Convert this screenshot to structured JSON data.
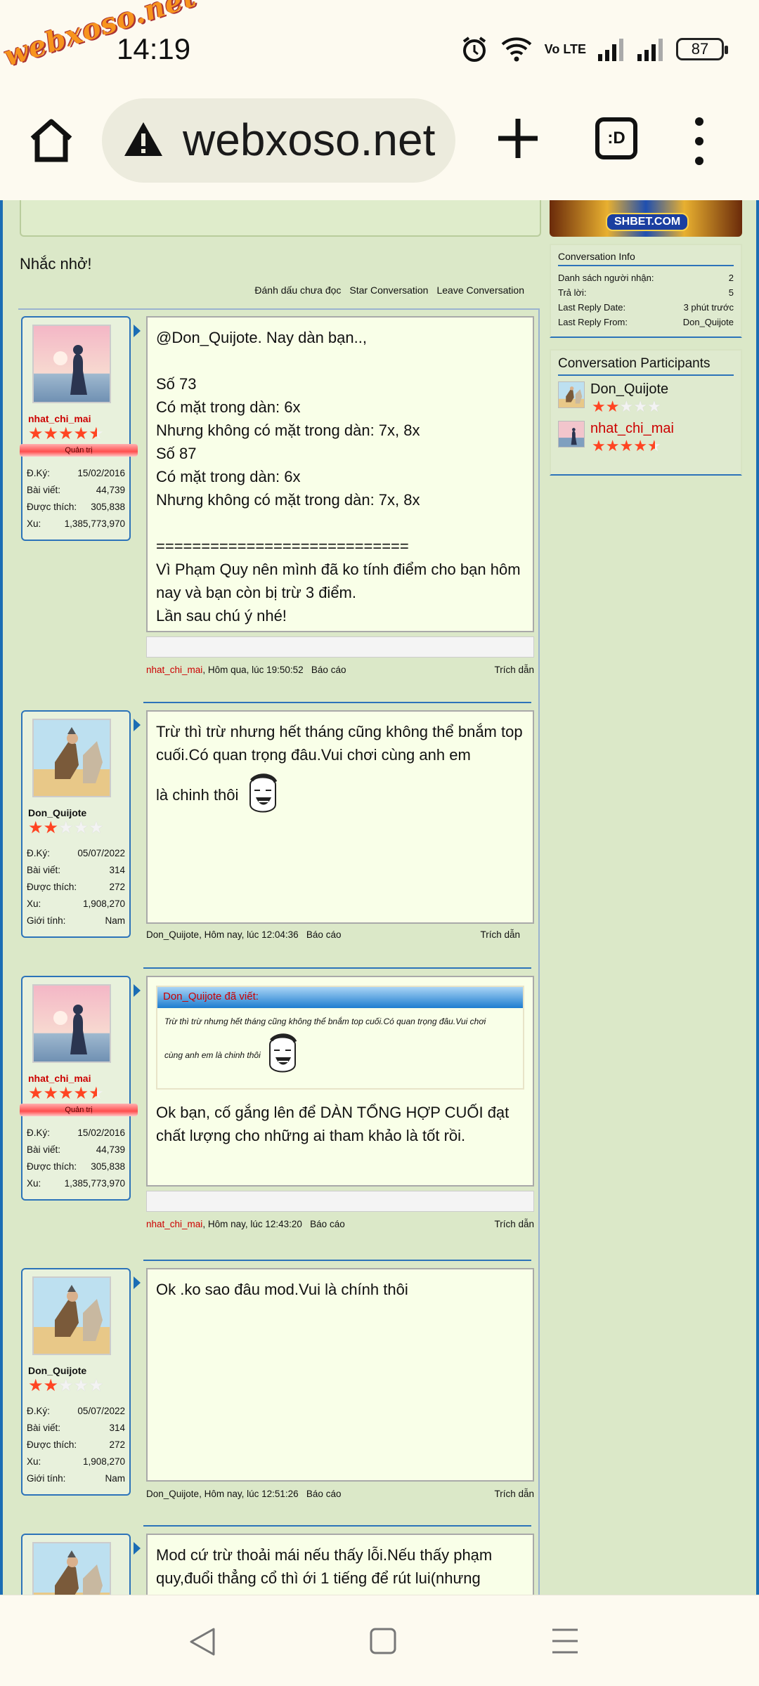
{
  "status": {
    "watermark": "webxoso.net",
    "time": "14:19",
    "volte": "Vo LTE",
    "battery": "87"
  },
  "browser": {
    "url": "webxoso.net",
    "tabs_label": ":D"
  },
  "conversation": {
    "title": "Nhắc nhở!",
    "actions": [
      "Đánh dấu chưa đọc",
      "Star Conversation",
      "Leave Conversation"
    ]
  },
  "users": {
    "nhat": {
      "name": "nhat_chi_mai",
      "role": "Quản trị",
      "rating": 4.5,
      "stats": [
        [
          "Đ.Ký:",
          "15/02/2016"
        ],
        [
          "Bài viết:",
          "44,739"
        ],
        [
          "Được thích:",
          "305,838"
        ],
        [
          "Xu:",
          "1,385,773,970"
        ]
      ]
    },
    "don": {
      "name": "Don_Quijote",
      "rating": 2,
      "stats": [
        [
          "Đ.Ký:",
          "05/07/2022"
        ],
        [
          "Bài viết:",
          "314"
        ],
        [
          "Được thích:",
          "272"
        ],
        [
          "Xu:",
          "1,908,270"
        ],
        [
          "Giới tính:",
          "Nam"
        ]
      ]
    }
  },
  "posts": [
    {
      "user": "nhat",
      "lines": [
        "@Don_Quijote. Nay dàn bạn..,",
        "",
        "Số 73",
        "Có mặt trong dàn: 6x",
        "Nhưng không có mặt trong dàn: 7x, 8x",
        "Số 87",
        "Có mặt trong dàn: 6x",
        "Nhưng không có mặt trong dàn: 7x, 8x",
        "",
        "============================",
        "Vì Phạm Quy nên mình đã ko tính điểm cho bạn hôm nay và bạn còn bị trừ 3 điểm.",
        "Lần sau chú ý nhé!"
      ],
      "time": ", Hôm qua, lúc 19:50:52",
      "report": "Báo cáo",
      "quote": "Trích dẫn"
    },
    {
      "user": "don",
      "lines": [
        "Trừ thì trừ nhưng hết tháng cũng không thể bnắm top cuối.Có quan trọng đâu.Vui chơi cùng anh em",
        "là chinh thôi"
      ],
      "time": ", Hôm nay, lúc 12:04:36",
      "report": "Báo cáo",
      "quote": "Trích dẫn"
    },
    {
      "user": "nhat",
      "quote_head": "Don_Quijote đã viết:",
      "quote_body1": "Trừ thì trừ nhưng hết tháng cũng không thể bnắm top cuối.Có quan trọng đâu.Vui chơi",
      "quote_body2": "cùng anh em là chinh thôi",
      "lines": [
        "Ok bạn, cố gắng lên để DÀN TỔNG HỢP CUỐI đạt chất lượng cho những ai tham khảo là tốt rồi."
      ],
      "time": ", Hôm nay, lúc 12:43:20",
      "report": "Báo cáo",
      "quote": "Trích dẫn"
    },
    {
      "user": "don",
      "lines": [
        "Ok .ko sao đâu mod.Vui là chính thôi"
      ],
      "time": ", Hôm nay, lúc 12:51:26",
      "report": "Báo cáo",
      "quote": "Trích dẫn"
    },
    {
      "user": "don",
      "lines": [
        "Mod cứ trừ thoải mái nếu thấy lỗi.Nếu thấy phạm quy,đuổi thẳng cổ thì ới 1 tiếng để rút lui(nhưng"
      ]
    }
  ],
  "sidebar": {
    "banner": "SHBET.COM",
    "info_title": "Conversation Info",
    "info": [
      [
        "Danh sách người nhận:",
        "2"
      ],
      [
        "Trả lời:",
        "5"
      ],
      [
        "Last Reply Date:",
        "3 phút trước"
      ],
      [
        "Last Reply From:",
        "Don_Quijote"
      ]
    ],
    "participants_title": "Conversation Participants",
    "participants": [
      {
        "name": "Don_Quijote",
        "rating": 2
      },
      {
        "name": "nhat_chi_mai",
        "rating": 4.5
      }
    ]
  },
  "colors": {
    "forum_bg": "#dbe8c8",
    "accent_blue": "#1b6db4",
    "message_bg": "#f9ffe8",
    "name_red": "#cc0000",
    "star": "#ff4422"
  }
}
